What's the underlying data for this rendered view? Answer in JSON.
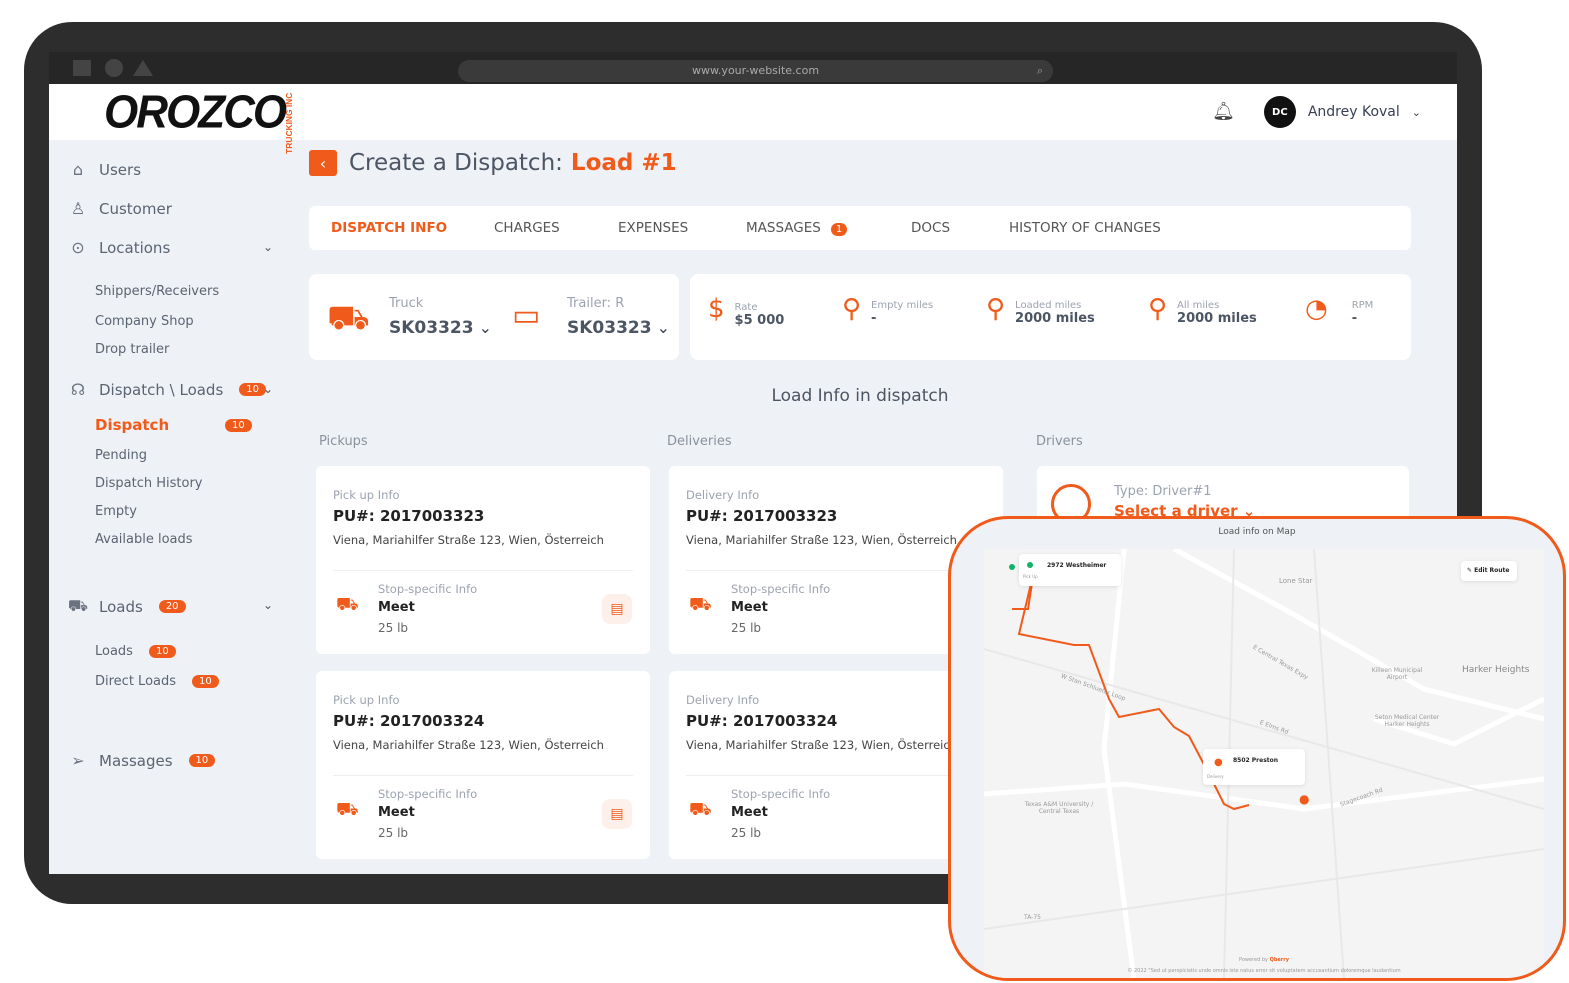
{
  "browser": {
    "url": "www.your-website.com"
  },
  "brand": {
    "logo_text": "OROZCO",
    "logo_sub": "TRUCKING INC",
    "accent": "#f05a1a"
  },
  "header": {
    "user_initials": "DC",
    "user_name": "Andrey Koval"
  },
  "sidebar": {
    "users": "Users",
    "customer": "Customer",
    "locations": "Locations",
    "location_items": [
      "Shippers/Receivers",
      "Company Shop",
      "Drop trailer"
    ],
    "dispatch_loads": "Dispatch \\ Loads",
    "dispatch_loads_badge": "10",
    "dispatch": "Dispatch",
    "dispatch_badge": "10",
    "dispatch_items": [
      "Pending",
      "Dispatch History",
      "Empty",
      "Available loads"
    ],
    "loads": "Loads",
    "loads_badge": "20",
    "loads_sub": "Loads",
    "loads_sub_badge": "10",
    "direct_loads": "Direct Loads",
    "direct_loads_badge": "10",
    "massages": "Massages",
    "massages_badge": "10"
  },
  "page": {
    "title_prefix": "Create a Dispatch:",
    "title_load": "Load #1"
  },
  "tabs": [
    {
      "label": "DISPATCH INFO"
    },
    {
      "label": "CHARGES"
    },
    {
      "label": "EXPENSES"
    },
    {
      "label": "MASSAGES",
      "badge": "1"
    },
    {
      "label": "DOCS"
    },
    {
      "label": "HISTORY OF CHANGES"
    }
  ],
  "equipment": {
    "truck_label": "Truck",
    "truck_value": "SK03323",
    "trailer_label": "Trailer: R",
    "trailer_value": "SK03323"
  },
  "stats": [
    {
      "label": "Rate",
      "value": "$5 000",
      "icon": "coins-dollar-icon"
    },
    {
      "label": "Empty miles",
      "value": "-",
      "icon": "route-pins-icon"
    },
    {
      "label": "Loaded miles",
      "value": "2000 miles",
      "icon": "route-pins-icon"
    },
    {
      "label": "All miles",
      "value": "2000 miles",
      "icon": "route-pins-icon"
    },
    {
      "label": "RPM",
      "value": "-",
      "icon": "speedometer-dollar-icon"
    }
  ],
  "load_info_title": "Load Info in dispatch",
  "sections": {
    "pickups": "Pickups",
    "deliveries": "Deliveries",
    "drivers": "Drivers"
  },
  "pickups": [
    {
      "type": "Pick up Info",
      "pu": "PU#: 2017003323",
      "address": "Viena, Mariahilfer Straße 123, Wien, Österreich",
      "stop_label": "Stop-specific Info",
      "commodity": "Meet",
      "weight": "25 lb"
    },
    {
      "type": "Pick up Info",
      "pu": "PU#: 2017003324",
      "address": "Viena, Mariahilfer Straße 123, Wien, Österreich",
      "stop_label": "Stop-specific Info",
      "commodity": "Meet",
      "weight": "25 lb"
    }
  ],
  "deliveries": [
    {
      "type": "Delivery Info",
      "pu": "PU#: 2017003323",
      "address": "Viena, Mariahilfer Straße 123, Wien, Österreich",
      "stop_label": "Stop-specific Info",
      "commodity": "Meet",
      "weight": "25 lb"
    },
    {
      "type": "Delivery Info",
      "pu": "PU#: 2017003324",
      "address": "Viena, Mariahilfer Straße 123, Wien, Österreich",
      "stop_label": "Stop-specific Info",
      "commodity": "Meet",
      "weight": "25 lb"
    }
  ],
  "driver": {
    "type": "Type: Driver#1",
    "select": "Select a driver"
  },
  "map": {
    "title": "Load info on Map",
    "edit_route": "Edit Route",
    "pickup": {
      "name": "2972 Westheimer",
      "tag": "Pick Up"
    },
    "delivery": {
      "name": "8502 Preston",
      "tag": "Delivery"
    },
    "labels": [
      "Lone Star",
      "Harker Heights",
      "Killeen Municipal Airport",
      "Seton Medical Center Harker Heights",
      "Texas A&M University / Central Texas",
      "E Central Texas Expy",
      "W Stan Schlueter Loop",
      "Stagecoach Rd",
      "E Elms Rd",
      "TA-75"
    ],
    "powered_by": "Powered by",
    "powered_brand": "Qberry",
    "footer": "© 2022 \"Sed ut perspiciatis unde omnis iste natus error sit voluptatem accusantium doloremque laudantium"
  }
}
